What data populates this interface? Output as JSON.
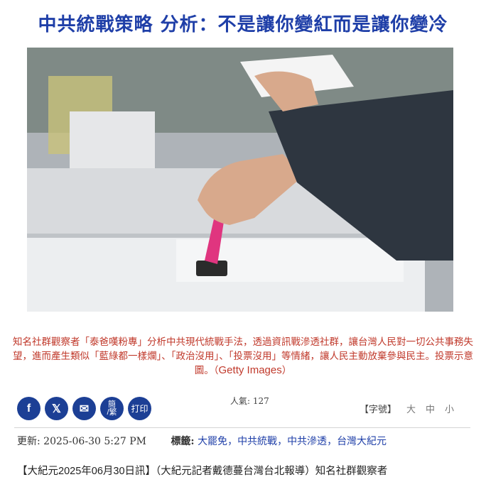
{
  "article": {
    "title": "中共統戰策略 分析：不是讓你變紅而是讓你變冷",
    "caption_main": "知名社群觀察者「泰爸嘆粉專」分析中共現代統戰手法，透過資訊戰滲透社群，讓台灣人民對一切公共事務失望，進而產生類似「藍綠都一樣爛」、「政治沒用」、「投票沒用」等情緒，讓人民主動放棄參與民主。投票示意圖。（",
    "caption_credit": "Getty Images",
    "caption_end": "）"
  },
  "share": {
    "facebook": "f",
    "x": "𝕏",
    "email": "✉",
    "simp_trad_top": "簡",
    "simp_trad_bottom": "/繁",
    "print": "打印"
  },
  "popularity": "人氣: 127",
  "font_size": {
    "label": "【字號】",
    "large": "大",
    "medium": "中",
    "small": "小"
  },
  "meta": {
    "updated": "更新: 2025-06-30 5:27 PM",
    "tags_label": "標籤:",
    "tags": [
      "大罷免",
      "中共統戰",
      "中共滲透",
      "台灣大紀元"
    ]
  },
  "body": {
    "lead_a": "【大紀元",
    "lead_date": "2025年06月30日",
    "lead_b": "訊】（大紀元記者戴德蔓台灣台北報導）知名社群觀察者"
  },
  "colors": {
    "title": "#1f3fa8",
    "caption": "#c0392b",
    "share_button": "#1c3f95",
    "tag_link": "#1f3fa8"
  }
}
